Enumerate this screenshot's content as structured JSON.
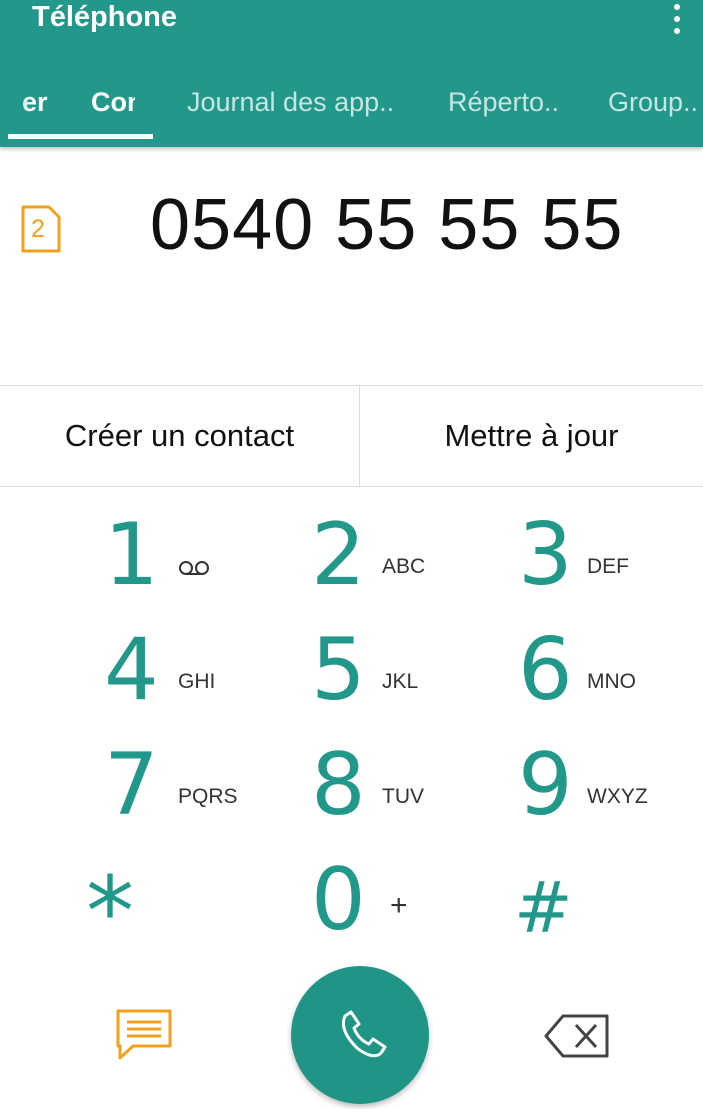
{
  "app": {
    "title": "Téléphone"
  },
  "tabs": [
    {
      "label": "er"
    },
    {
      "label": "Con"
    },
    {
      "label": "Journal des app.."
    },
    {
      "label": "Réperto.."
    },
    {
      "label": "Group.."
    }
  ],
  "sim": {
    "label": "2"
  },
  "dialed_number": "0540 55 55 55",
  "actions": {
    "create_contact": "Créer un contact",
    "update": "Mettre à jour"
  },
  "keypad": [
    {
      "digit": "1",
      "letters": "voicemail-icon"
    },
    {
      "digit": "2",
      "letters": "ABC"
    },
    {
      "digit": "3",
      "letters": "DEF"
    },
    {
      "digit": "4",
      "letters": "GHI"
    },
    {
      "digit": "5",
      "letters": "JKL"
    },
    {
      "digit": "6",
      "letters": "MNO"
    },
    {
      "digit": "7",
      "letters": "PQRS"
    },
    {
      "digit": "8",
      "letters": "TUV"
    },
    {
      "digit": "9",
      "letters": "WXYZ"
    },
    {
      "digit": "*",
      "letters": ""
    },
    {
      "digit": "0",
      "letters": "+"
    },
    {
      "digit": "#",
      "letters": ""
    }
  ],
  "icons": {
    "menu": "more-vert-icon",
    "sim": "sim-card-icon",
    "message": "message-icon",
    "call": "phone-icon",
    "delete": "backspace-icon"
  },
  "colors": {
    "accent": "#22988a",
    "sim_orange": "#f5a01a",
    "call_button": "#1f9585"
  }
}
